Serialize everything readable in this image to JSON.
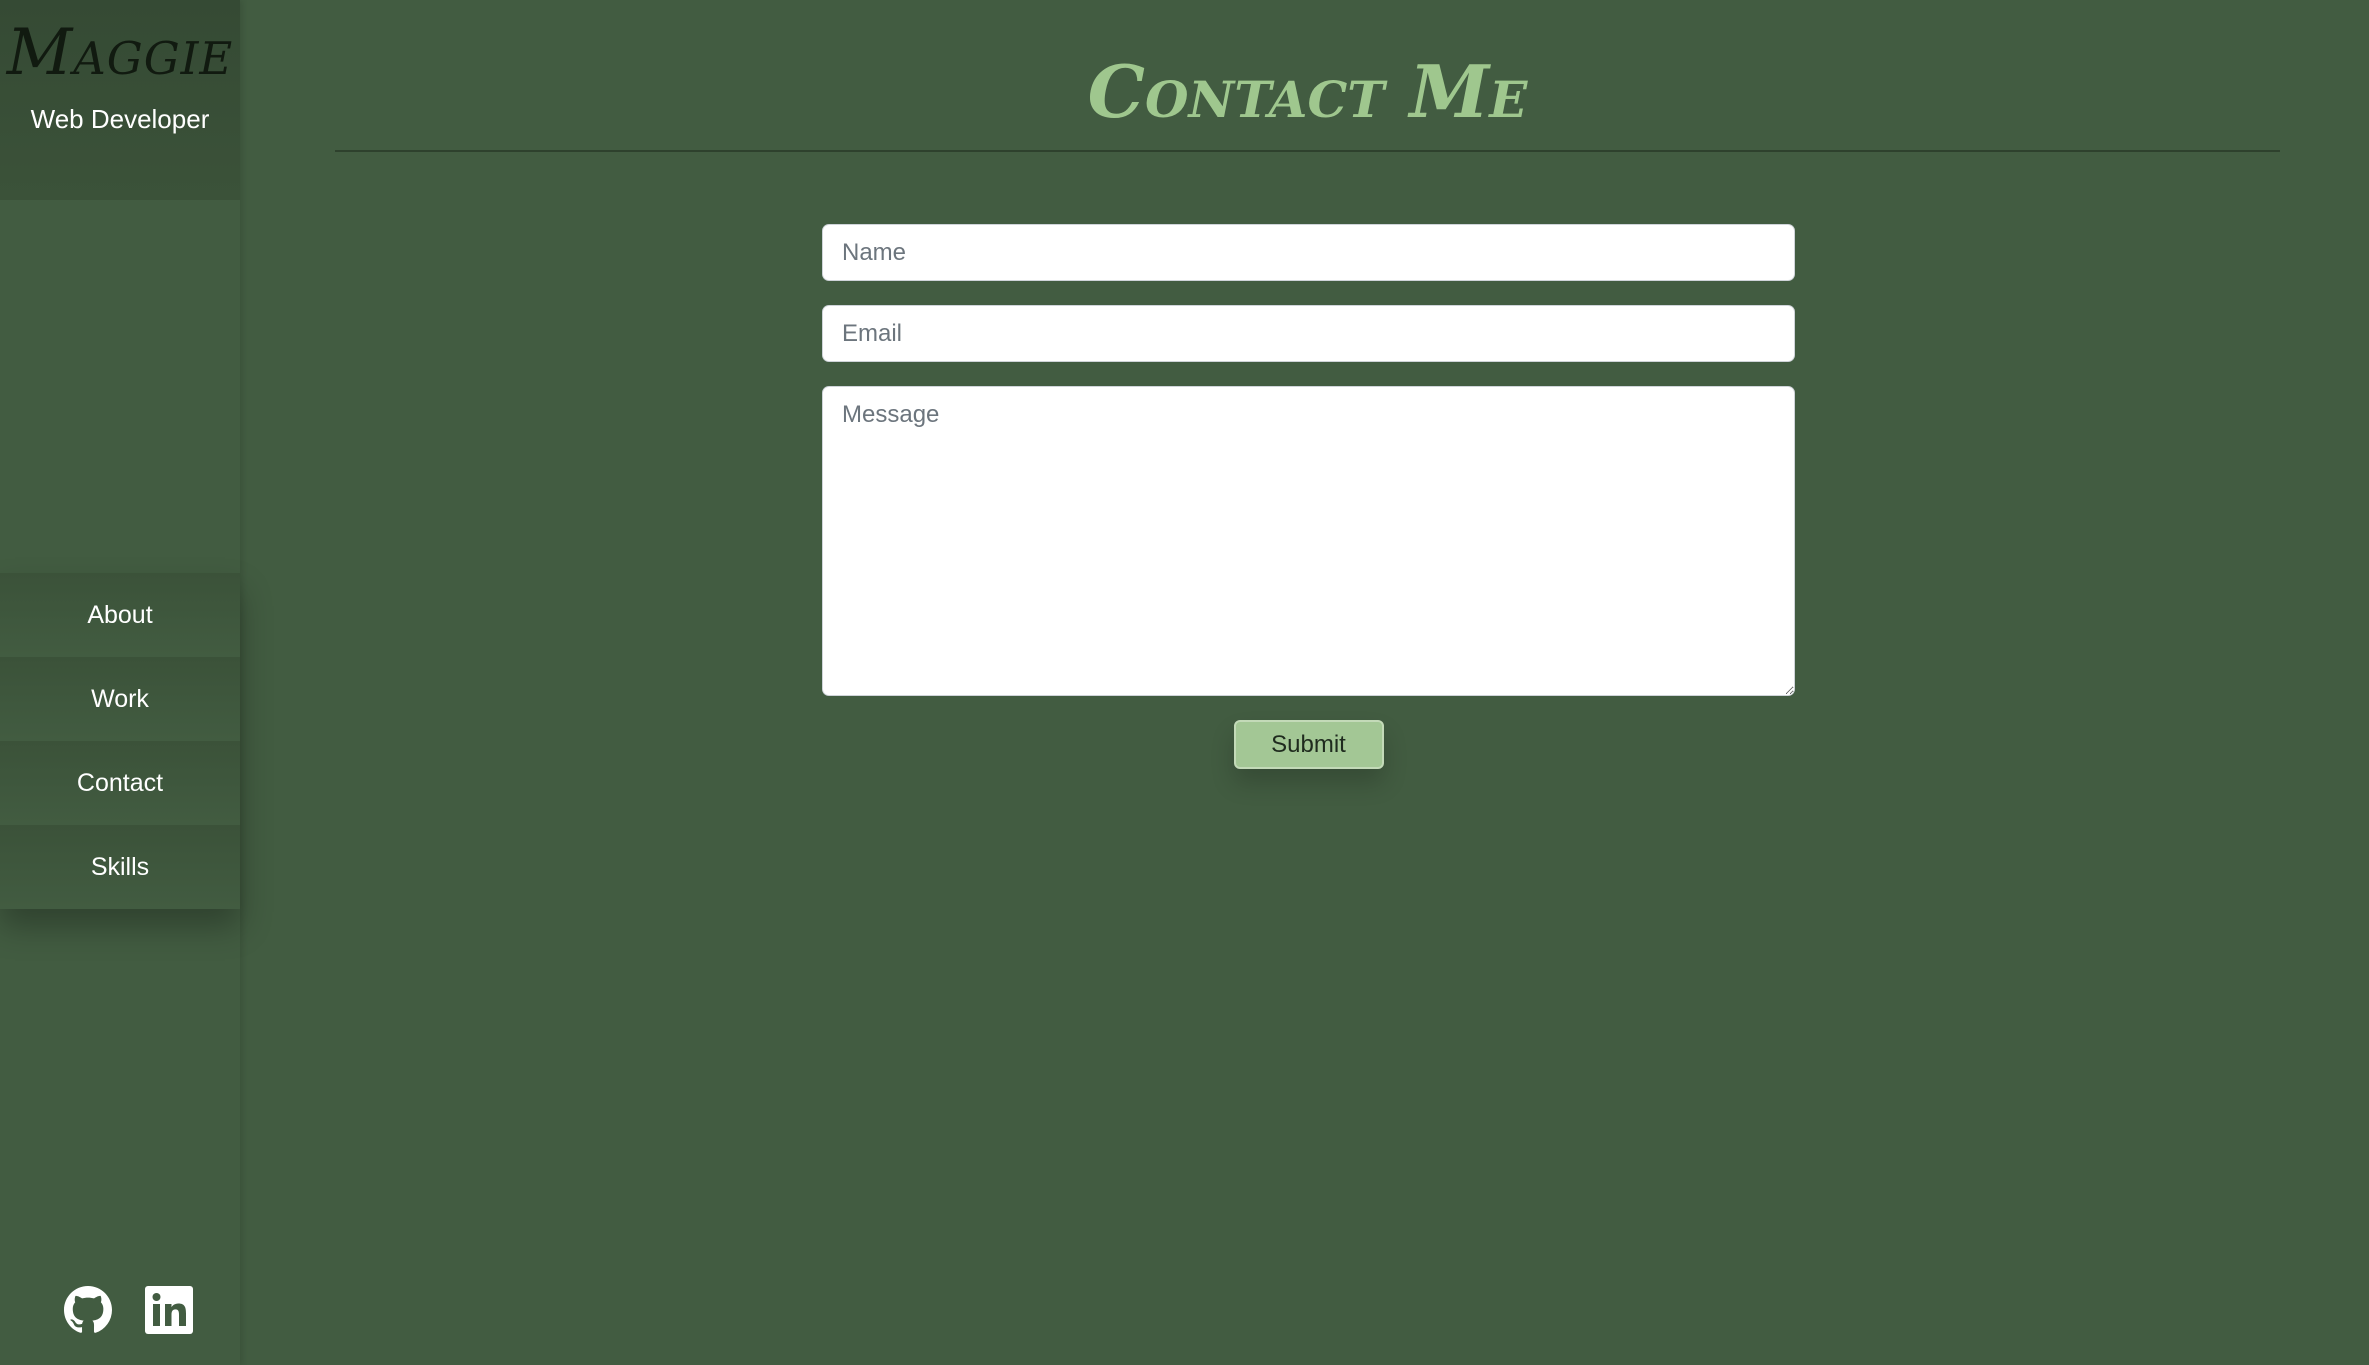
{
  "sidebar": {
    "brand_name": "Maggie",
    "brand_role": "Web Developer",
    "nav": [
      {
        "label": "About"
      },
      {
        "label": "Work"
      },
      {
        "label": "Contact"
      },
      {
        "label": "Skills"
      }
    ],
    "social": [
      {
        "icon": "github-icon"
      },
      {
        "icon": "linkedin-icon"
      }
    ]
  },
  "main": {
    "title": "Contact Me",
    "form": {
      "name_placeholder": "Name",
      "email_placeholder": "Email",
      "message_placeholder": "Message",
      "submit_label": "Submit"
    }
  },
  "colors": {
    "background": "#425c41",
    "accent": "#9fc78e",
    "button": "#a3c795"
  }
}
